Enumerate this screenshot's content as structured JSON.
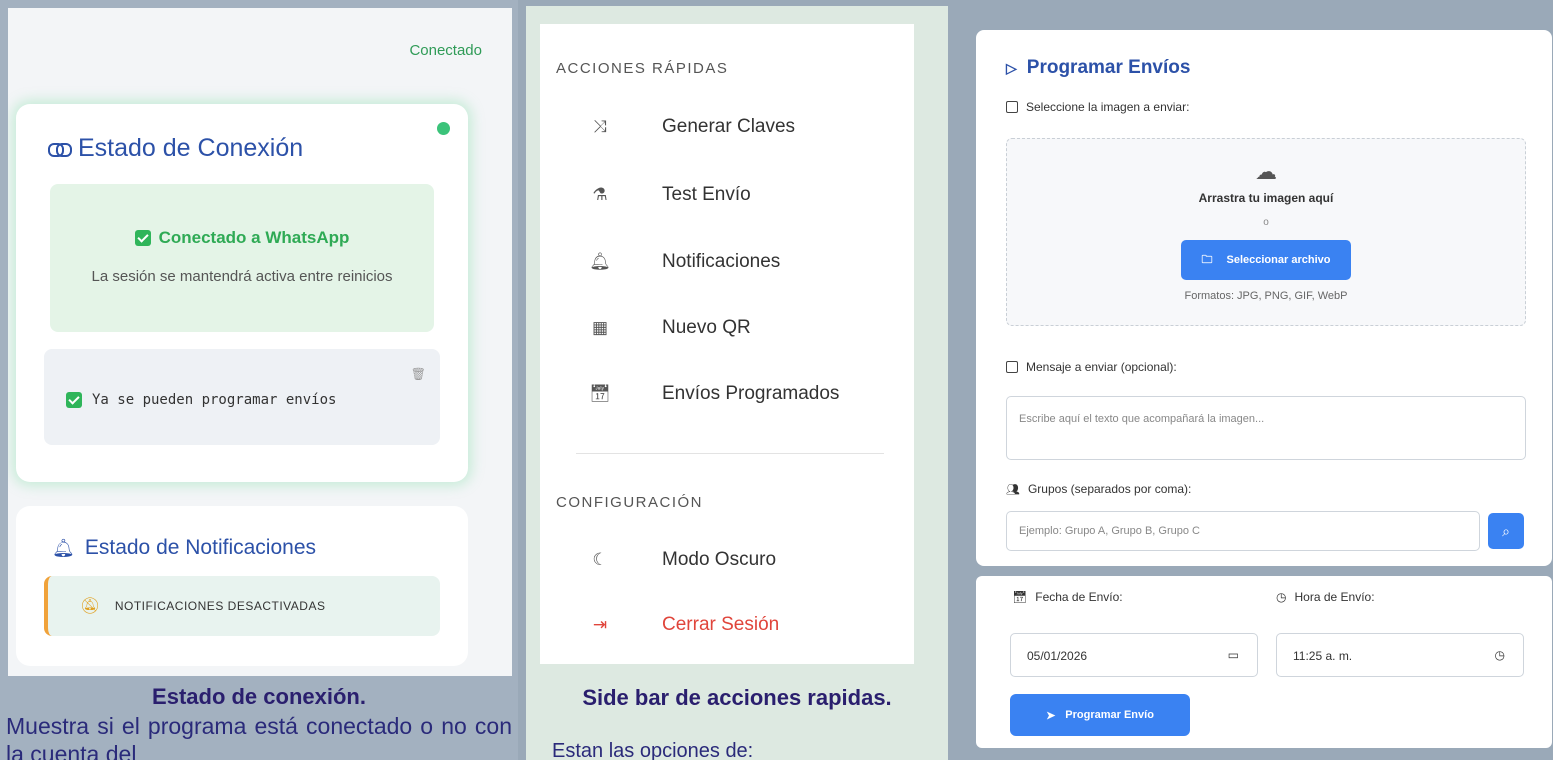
{
  "panel1": {
    "header_status": "Conectado",
    "connection_title": "Estado de Conexión",
    "whatsapp_status": "Conectado a WhatsApp",
    "session_note": "La sesión se mantendrá activa entre reinicios",
    "ready_note": "Ya se pueden programar envíos",
    "notif_title": "Estado de Notificaciones",
    "notif_status": "NOTIFICACIONES DESACTIVADAS",
    "caption_title": "Estado de conexión.",
    "caption_text": "Muestra si el programa está conectado o no con la cuenta del"
  },
  "panel2": {
    "section_quick": "ACCIONES RÁPIDAS",
    "quick_items": [
      {
        "label": "Generar Claves",
        "icon": "shuffle-icon"
      },
      {
        "label": "Test Envío",
        "icon": "flask-icon"
      },
      {
        "label": "Notificaciones",
        "icon": "bell-icon"
      },
      {
        "label": "Nuevo QR",
        "icon": "qr-icon"
      },
      {
        "label": "Envíos Programados",
        "icon": "calendar-arrow-icon"
      }
    ],
    "section_config": "CONFIGURACIÓN",
    "config_items": [
      {
        "label": "Modo Oscuro",
        "icon": "moon-icon"
      },
      {
        "label": "Cerrar Sesión",
        "icon": "logout-icon"
      }
    ],
    "caption_title": "Side bar de acciones rapidas.",
    "caption_text": "Estan las opciones de:"
  },
  "panel3": {
    "title": "Programar Envíos",
    "image_label": "Seleccione la imagen a enviar:",
    "drop_text": "Arrastra tu imagen aquí",
    "drop_or": "o",
    "select_button": "Seleccionar archivo",
    "formats": "Formatos: JPG, PNG, GIF, WebP",
    "message_label": "Mensaje a enviar (opcional):",
    "message_placeholder": "Escribe aquí el texto que acompañará la imagen...",
    "groups_label": "Grupos (separados por coma):",
    "groups_placeholder": "Ejemplo: Grupo A, Grupo B, Grupo C",
    "date_label": "Fecha de Envío:",
    "date_value": "05/01/2026",
    "time_label": "Hora de Envío:",
    "time_value": "11:25 a. m.",
    "schedule_button": "Programar Envío"
  },
  "colors": {
    "accent_blue": "#3a82f2",
    "title_blue": "#2c51a8",
    "success_green": "#2faa55",
    "danger_red": "#e0453b"
  }
}
